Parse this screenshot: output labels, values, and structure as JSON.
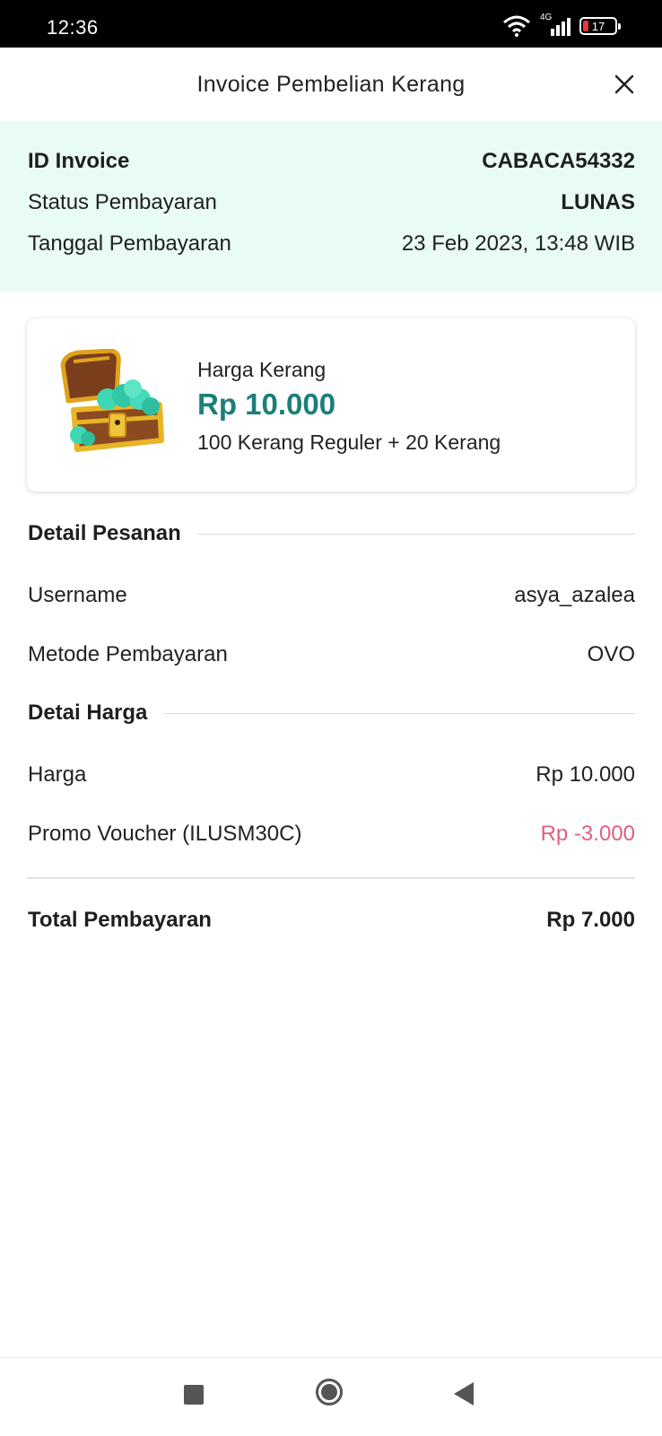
{
  "status_bar": {
    "time": "12:36",
    "network": "4G",
    "battery": "17"
  },
  "header": {
    "title": "Invoice Pembelian Kerang"
  },
  "invoice": {
    "id_label": "ID Invoice",
    "id_value": "CABACA54332",
    "status_label": "Status Pembayaran",
    "status_value": "LUNAS",
    "date_label": "Tanggal Pembayaran",
    "date_value": "23 Feb 2023, 13:48 WIB"
  },
  "product": {
    "label": "Harga Kerang",
    "price": "Rp 10.000",
    "description": "100 Kerang Reguler + 20 Kerang",
    "icon": "treasure-chest-icon"
  },
  "order_detail": {
    "title": "Detail Pesanan",
    "username_label": "Username",
    "username_value": "asya_azalea",
    "method_label": "Metode Pembayaran",
    "method_value": "OVO"
  },
  "price_detail": {
    "title": "Detai Harga",
    "price_label": "Harga",
    "price_value": "Rp 10.000",
    "voucher_label": "Promo Voucher (ILUSM30C)",
    "voucher_value": "Rp -3.000"
  },
  "total": {
    "label": "Total Pembayaran",
    "value": "Rp 7.000"
  },
  "colors": {
    "accent": "#1b7f7a",
    "summary_bg": "#e9fbf5",
    "discount": "#e0607e"
  }
}
